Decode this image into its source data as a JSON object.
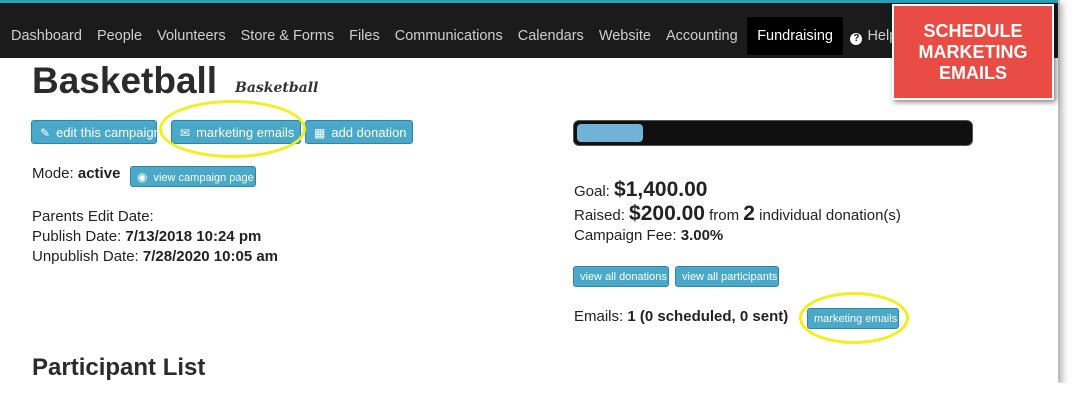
{
  "nav": {
    "items": [
      "Dashboard",
      "People",
      "Volunteers",
      "Store & Forms",
      "Files",
      "Communications",
      "Calendars",
      "Website",
      "Accounting"
    ],
    "active": "Fundraising",
    "help": "Help"
  },
  "callout": {
    "line1": "SCHEDULE",
    "line2": "MARKETING",
    "line3": "EMAILS"
  },
  "campaign": {
    "title": "Basketball",
    "subtitle": "Basketball",
    "buttons": {
      "edit": "edit this campaign",
      "marketing": "marketing emails",
      "add_donation": "add donation"
    },
    "mode_label": "Mode:",
    "mode_value": "active",
    "view_page": "view campaign page",
    "parents_edit": "Parents Edit Date:",
    "publish_label": "Publish Date:",
    "publish_value": "7/13/2018 10:24 pm",
    "unpublish_label": "Unpublish Date:",
    "unpublish_value": "7/28/2020 10:05 am"
  },
  "stats": {
    "progress_fraction": 0.143,
    "goal_label": "Goal:",
    "goal_value": "$1,400.00",
    "raised_label": "Raised:",
    "raised_value": "$200.00",
    "from_text": "from",
    "donation_count": "2",
    "donations_text": "individual donation(s)",
    "fee_label": "Campaign Fee:",
    "fee_value": "3.00%",
    "view_donations": "view all donations",
    "view_participants": "view all participants",
    "emails_label": "Emails:",
    "emails_value": "1 (0 scheduled, 0 sent)",
    "marketing_emails": "marketing emails"
  },
  "participant_list_title": "Participant List",
  "colors": {
    "button": "#4aa8c8",
    "callout": "#e84c44",
    "highlight": "#f2ef1a",
    "nav_bg": "#1b1b1b",
    "progress_fill": "#6fb3d6"
  }
}
